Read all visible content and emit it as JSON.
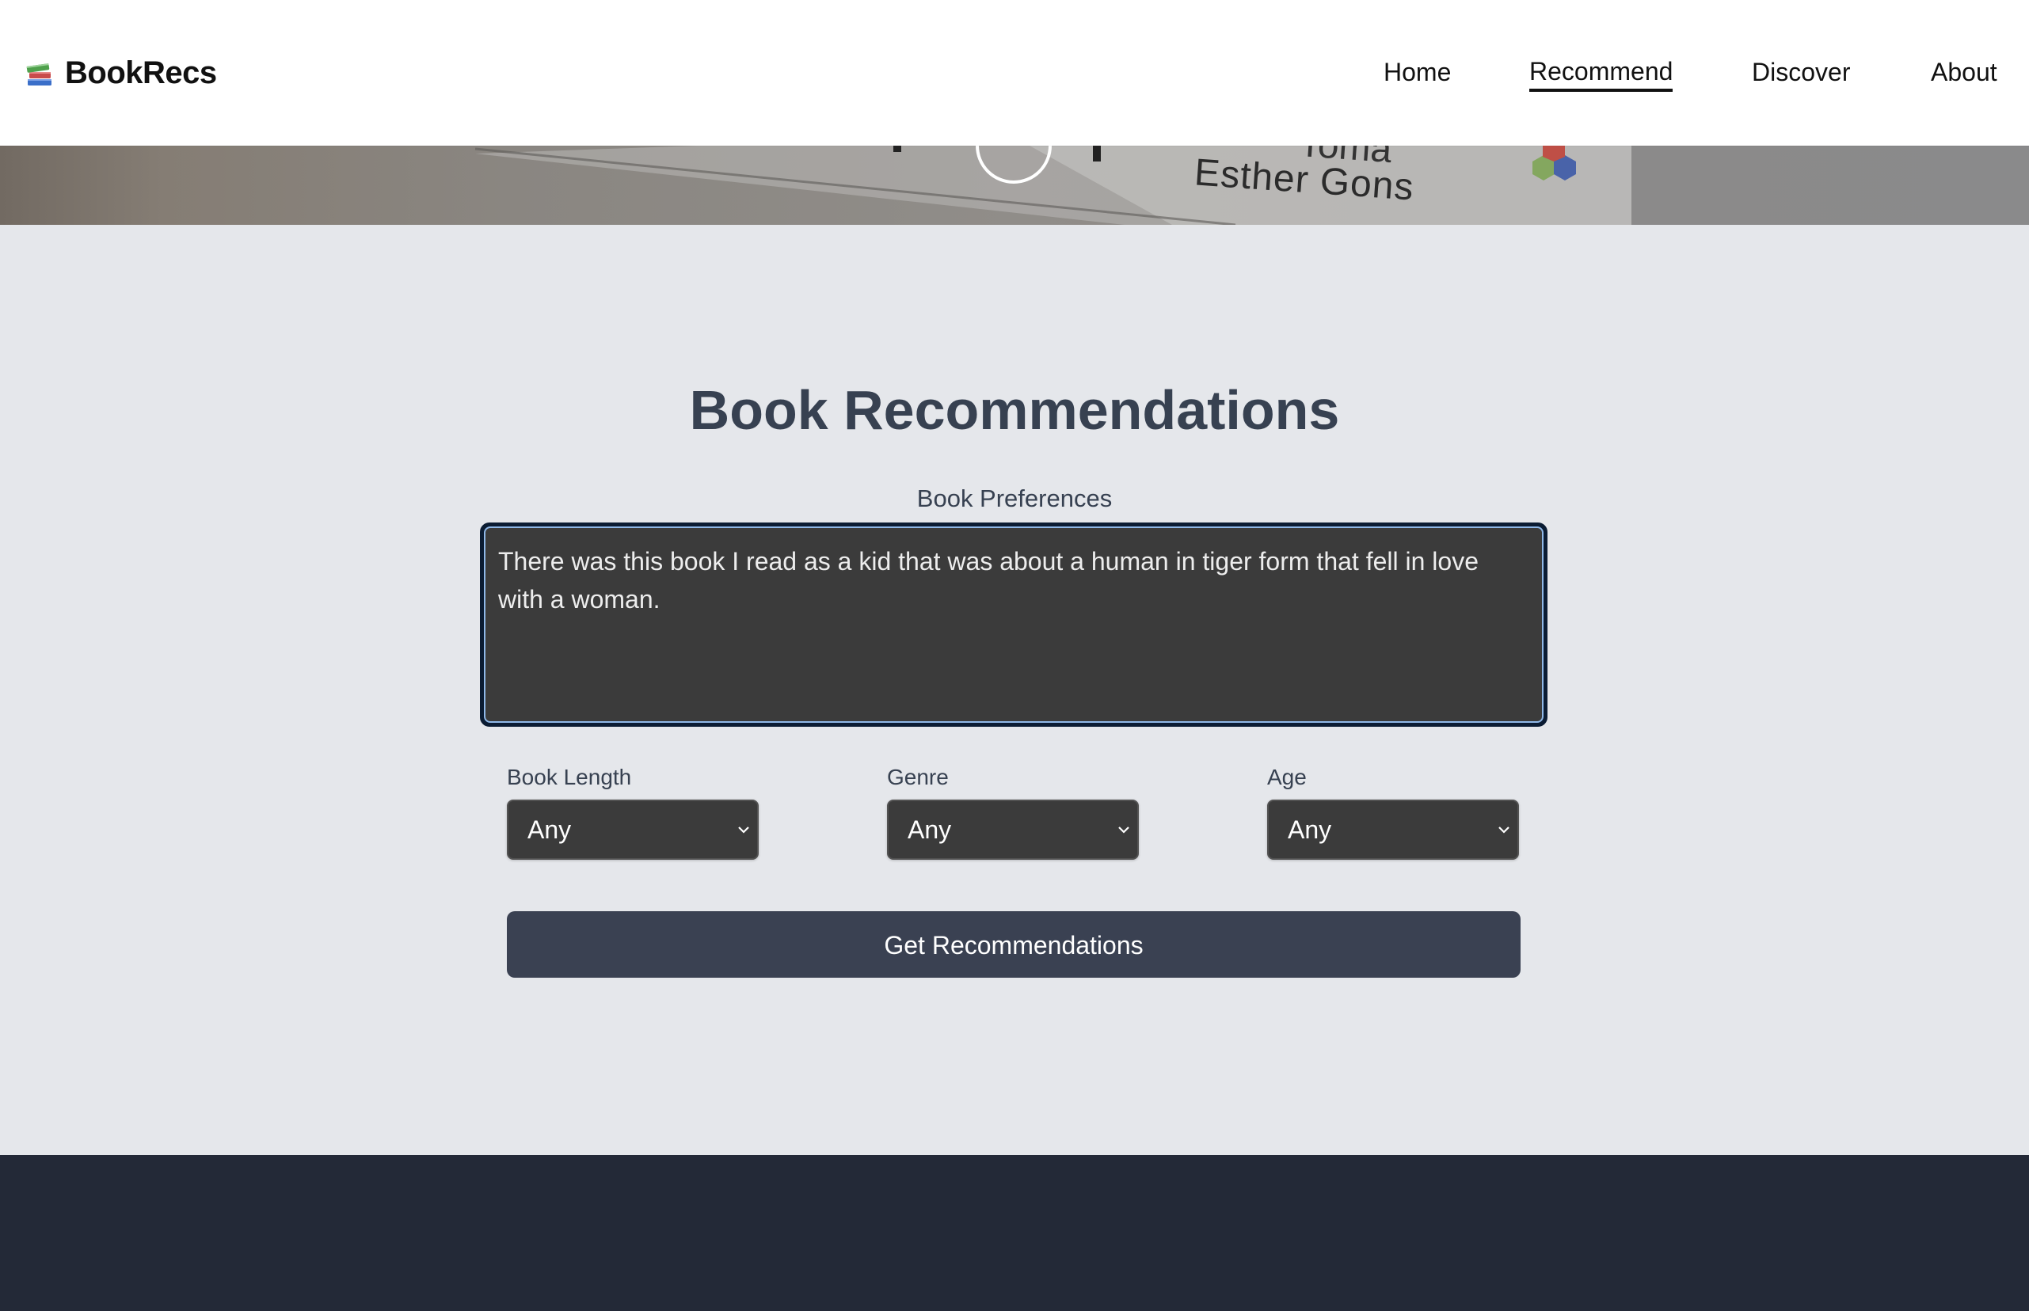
{
  "brand": {
    "logo_icon": "books-icon",
    "name": "BookRecs"
  },
  "nav": {
    "items": [
      {
        "label": "Home",
        "active": false
      },
      {
        "label": "Recommend",
        "active": true
      },
      {
        "label": "Discover",
        "active": false
      },
      {
        "label": "About",
        "active": false
      }
    ]
  },
  "hero": {
    "visible_text_line1": "Toma",
    "visible_text_line2": "Esther Gons"
  },
  "main": {
    "title": "Book Recommendations",
    "preferences": {
      "label": "Book Preferences",
      "value": "There was this book I read as a kid that was about a human in tiger form that fell in love with a woman. "
    },
    "filters": [
      {
        "label": "Book Length",
        "selected": "Any"
      },
      {
        "label": "Genre",
        "selected": "Any"
      },
      {
        "label": "Age",
        "selected": "Any"
      }
    ],
    "submit_label": "Get Recommendations"
  },
  "colors": {
    "page_bg": "#e5e7eb",
    "heading": "#374151",
    "input_bg": "#3b3b3b",
    "button_bg": "#3a4152",
    "footer_bg": "#232937",
    "focus_ring": "#8fb8e8"
  }
}
